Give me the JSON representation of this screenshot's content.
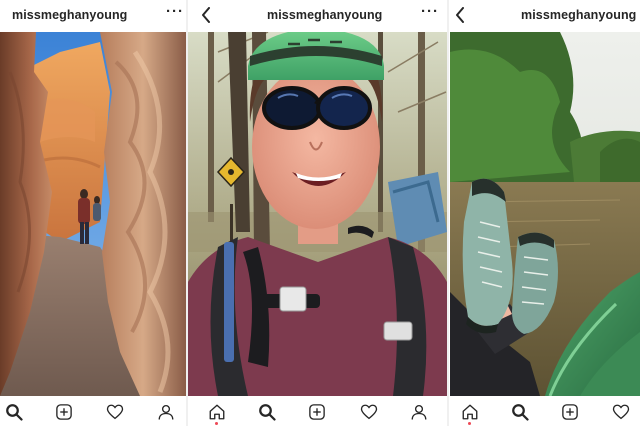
{
  "screens": [
    {
      "username": "missmeghanyoung",
      "more_label": "···",
      "photo_icon": "slot-canyon-hiker-photo",
      "nav": [
        "search-icon",
        "add-post-icon",
        "heart-icon",
        "profile-icon"
      ]
    },
    {
      "username": "missmeghanyoung",
      "more_label": "···",
      "back_icon": "back-chevron-icon",
      "photo_icon": "selfie-with-helmet-photo",
      "nav": [
        "home-icon",
        "search-icon",
        "add-post-icon",
        "heart-icon",
        "profile-icon"
      ]
    },
    {
      "username": "missmeghanyoung",
      "back_icon": "back-chevron-icon",
      "photo_icon": "river-boat-shoes-photo",
      "nav": [
        "home-icon",
        "search-icon",
        "add-post-icon",
        "heart-icon"
      ]
    }
  ],
  "colors": {
    "text": "#262626",
    "notification_dot": "#ed4956",
    "divider": "#f0f0f0"
  }
}
